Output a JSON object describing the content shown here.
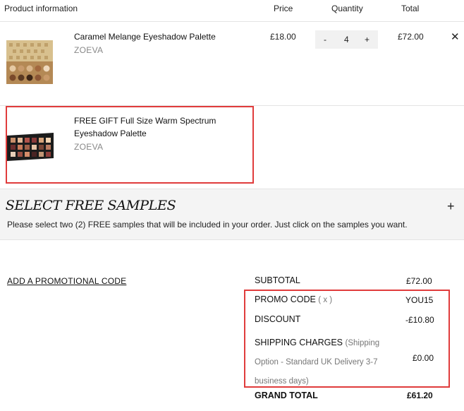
{
  "table_header": {
    "product": "Product information",
    "price": "Price",
    "quantity": "Quantity",
    "total": "Total"
  },
  "items": [
    {
      "name": "Caramel Melange Eyeshadow Palette",
      "brand": "ZOEVA",
      "price": "£18.00",
      "qty_minus": "-",
      "quantity": "4",
      "qty_plus": "+",
      "total": "£72.00",
      "remove": "✕"
    },
    {
      "name_line1": "FREE GIFT Full Size Warm Spectrum",
      "name_line2": "Eyeshadow Palette",
      "brand": "ZOEVA"
    }
  ],
  "samples": {
    "title": "SELECT FREE SAMPLES",
    "toggle": "+",
    "description": "Please select two (2) FREE samples that will be included in your order. Just click on the samples you want."
  },
  "promo_link": "ADD A PROMOTIONAL CODE",
  "summary": {
    "subtotal_label": "SUBTOTAL",
    "subtotal_value": "£72.00",
    "promo_label": "PROMO CODE",
    "promo_remove": "( x )",
    "promo_value": "YOU15",
    "discount_label": "DISCOUNT",
    "discount_value": "-£10.80",
    "shipping_label": "SHIPPING CHARGES",
    "shipping_note_1": "(Shipping",
    "shipping_note_2": "Option - Standard UK Delivery 3-7",
    "shipping_note_3": "business days)",
    "shipping_value": "£0.00",
    "grand_label": "GRAND TOTAL",
    "grand_value": "£61.20"
  },
  "colors": {
    "highlight": "#e03c3c",
    "samples_bg": "#f4f4f4",
    "qty_bg": "#f1f1f1"
  }
}
